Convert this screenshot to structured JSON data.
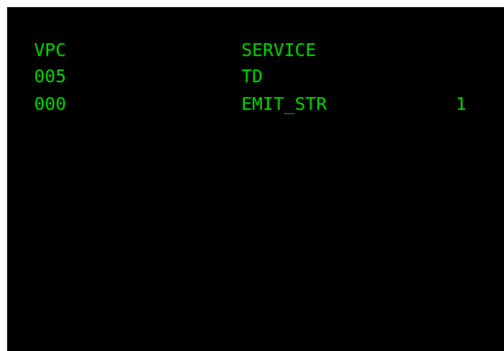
{
  "colors": {
    "background": "#000000",
    "text": "#00e000"
  },
  "header": {
    "vpc": "VPC",
    "service": "SERVICE"
  },
  "rows": [
    {
      "vpc": "005",
      "service": "TD",
      "count": ""
    },
    {
      "vpc": "000",
      "service": "EMIT_STR",
      "count": "1"
    }
  ]
}
